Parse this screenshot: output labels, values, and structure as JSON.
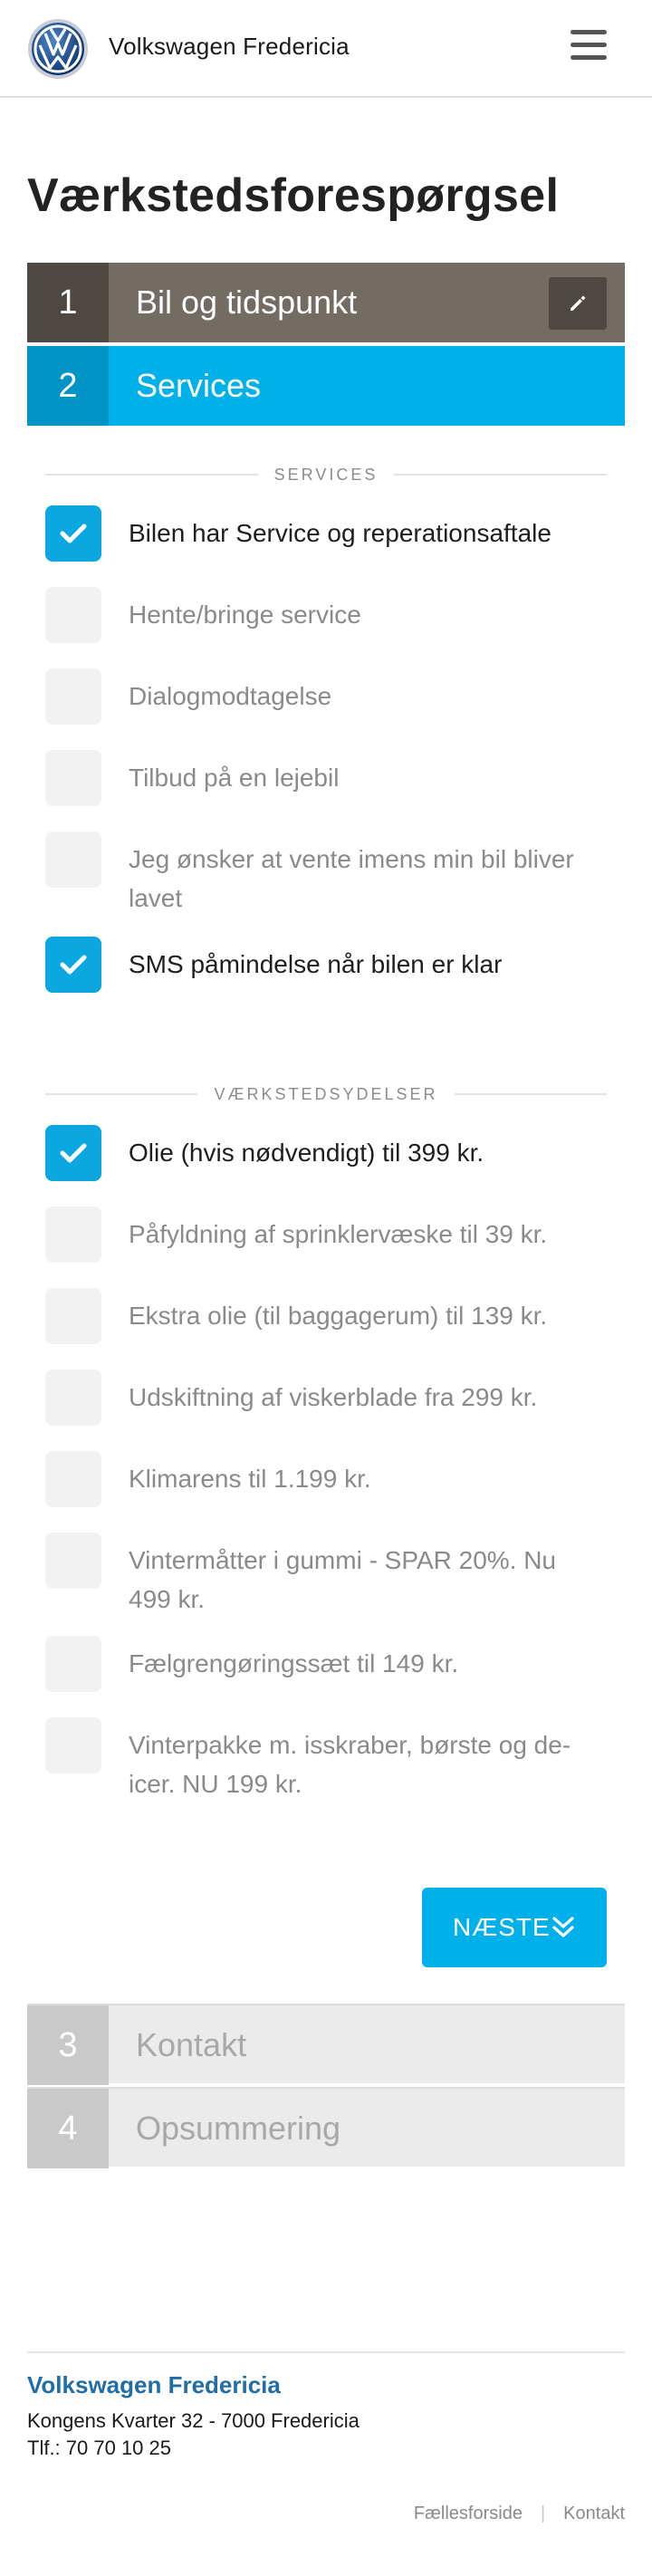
{
  "header": {
    "brand": "Volkswagen Fredericia",
    "logo_icon": "vw-logo-icon",
    "menu_icon": "hamburger-menu-icon"
  },
  "page": {
    "title": "Værkstedsforespørgsel"
  },
  "steps": [
    {
      "number": "1",
      "label": "Bil og tidspunkt",
      "state": "completed"
    },
    {
      "number": "2",
      "label": "Services",
      "state": "active"
    },
    {
      "number": "3",
      "label": "Kontakt",
      "state": "pending"
    },
    {
      "number": "4",
      "label": "Opsummering",
      "state": "pending"
    }
  ],
  "services": {
    "heading": "SERVICES",
    "items": [
      {
        "label": "Bilen har Service og reperationsaftale",
        "checked": true
      },
      {
        "label": "Hente/bringe service",
        "checked": false
      },
      {
        "label": "Dialogmodtagelse",
        "checked": false
      },
      {
        "label": "Tilbud på en lejebil",
        "checked": false
      },
      {
        "label": "Jeg ønsker at vente imens min bil bliver lavet",
        "checked": false
      },
      {
        "label": "SMS påmindelse når bilen er klar",
        "checked": true
      }
    ]
  },
  "extras": {
    "heading": "VÆRKSTEDSYDELSER",
    "items": [
      {
        "label": "Olie (hvis nødvendigt) til 399 kr.",
        "checked": true
      },
      {
        "label": "Påfyldning af sprinklervæske til 39 kr.",
        "checked": false
      },
      {
        "label": "Ekstra olie (til baggagerum) til 139 kr.",
        "checked": false
      },
      {
        "label": "Udskiftning af viskerblade fra 299 kr.",
        "checked": false
      },
      {
        "label": "Klimarens til 1.199 kr.",
        "checked": false
      },
      {
        "label": "Vintermåtter i gummi - SPAR 20%. Nu 499 kr.",
        "checked": false
      },
      {
        "label": "Fælgrengøringssæt til 149 kr.",
        "checked": false
      },
      {
        "label": "Vinterpakke m. isskraber, børste og de-icer. NU 199 kr.",
        "checked": false
      }
    ]
  },
  "next_button": {
    "label": "NÆSTE"
  },
  "footer": {
    "dealer_name": "Volkswagen Fredericia",
    "address": "Kongens Kvarter 32 - 7000 Fredericia",
    "phone": "Tlf.: 70 70 10 25",
    "links": [
      "Fællesforside",
      "Kontakt"
    ]
  },
  "colors": {
    "accent": "#00b0e8",
    "completed_step": "#746b63",
    "pending_step": "#ebebeb",
    "footer_brand": "#1f6ea8"
  }
}
